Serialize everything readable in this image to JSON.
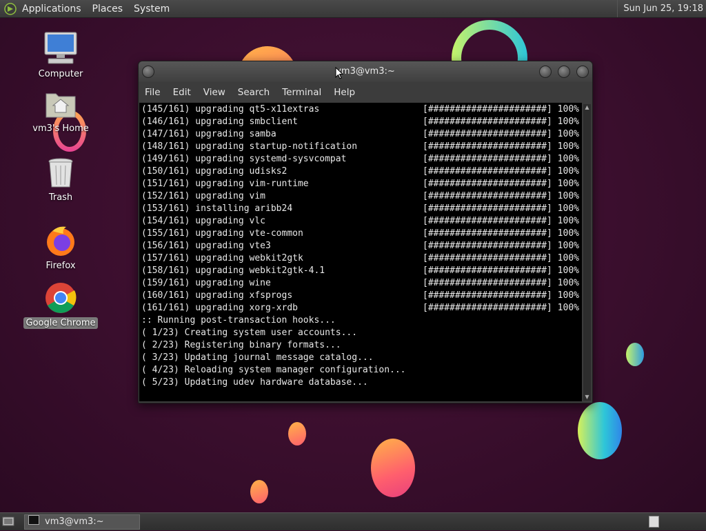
{
  "top_panel": {
    "menus": [
      "Applications",
      "Places",
      "System"
    ],
    "clock": "Sun Jun 25, 19:18"
  },
  "desktop_icons": [
    {
      "label": "Computer",
      "icon": "computer-icon"
    },
    {
      "label": "vm3's Home",
      "icon": "home-folder-icon"
    },
    {
      "label": "Trash",
      "icon": "trash-icon"
    },
    {
      "label": "Firefox",
      "icon": "firefox-icon"
    },
    {
      "label": "Google Chrome",
      "icon": "chrome-icon",
      "selected": true
    }
  ],
  "terminal": {
    "title": "vm3@vm3:~",
    "menus": [
      "File",
      "Edit",
      "View",
      "Search",
      "Terminal",
      "Help"
    ],
    "lines": [
      "(145/161) upgrading qt5-x11extras",
      "(146/161) upgrading smbclient",
      "(147/161) upgrading samba",
      "(148/161) upgrading startup-notification",
      "(149/161) upgrading systemd-sysvcompat",
      "(150/161) upgrading udisks2",
      "(151/161) upgrading vim-runtime",
      "(152/161) upgrading vim",
      "(153/161) installing aribb24",
      "(154/161) upgrading vlc",
      "(155/161) upgrading vte-common",
      "(156/161) upgrading vte3",
      "(157/161) upgrading webkit2gtk",
      "(158/161) upgrading webkit2gtk-4.1",
      "(159/161) upgrading wine",
      "(160/161) upgrading xfsprogs",
      "(161/161) upgrading xorg-xrdb",
      ":: Running post-transaction hooks...",
      "( 1/23) Creating system user accounts...",
      "( 2/23) Registering binary formats...",
      "( 3/23) Updating journal message catalog...",
      "( 4/23) Reloading system manager configuration...",
      "( 5/23) Updating udev hardware database..."
    ],
    "progress_bar": "[######################] 100%"
  },
  "taskbar": {
    "window_label": "vm3@vm3:~"
  },
  "colors": {
    "desktop_bg": "#3a0e2d",
    "terminal_bg": "#000000",
    "panel_bg": "#383838"
  }
}
